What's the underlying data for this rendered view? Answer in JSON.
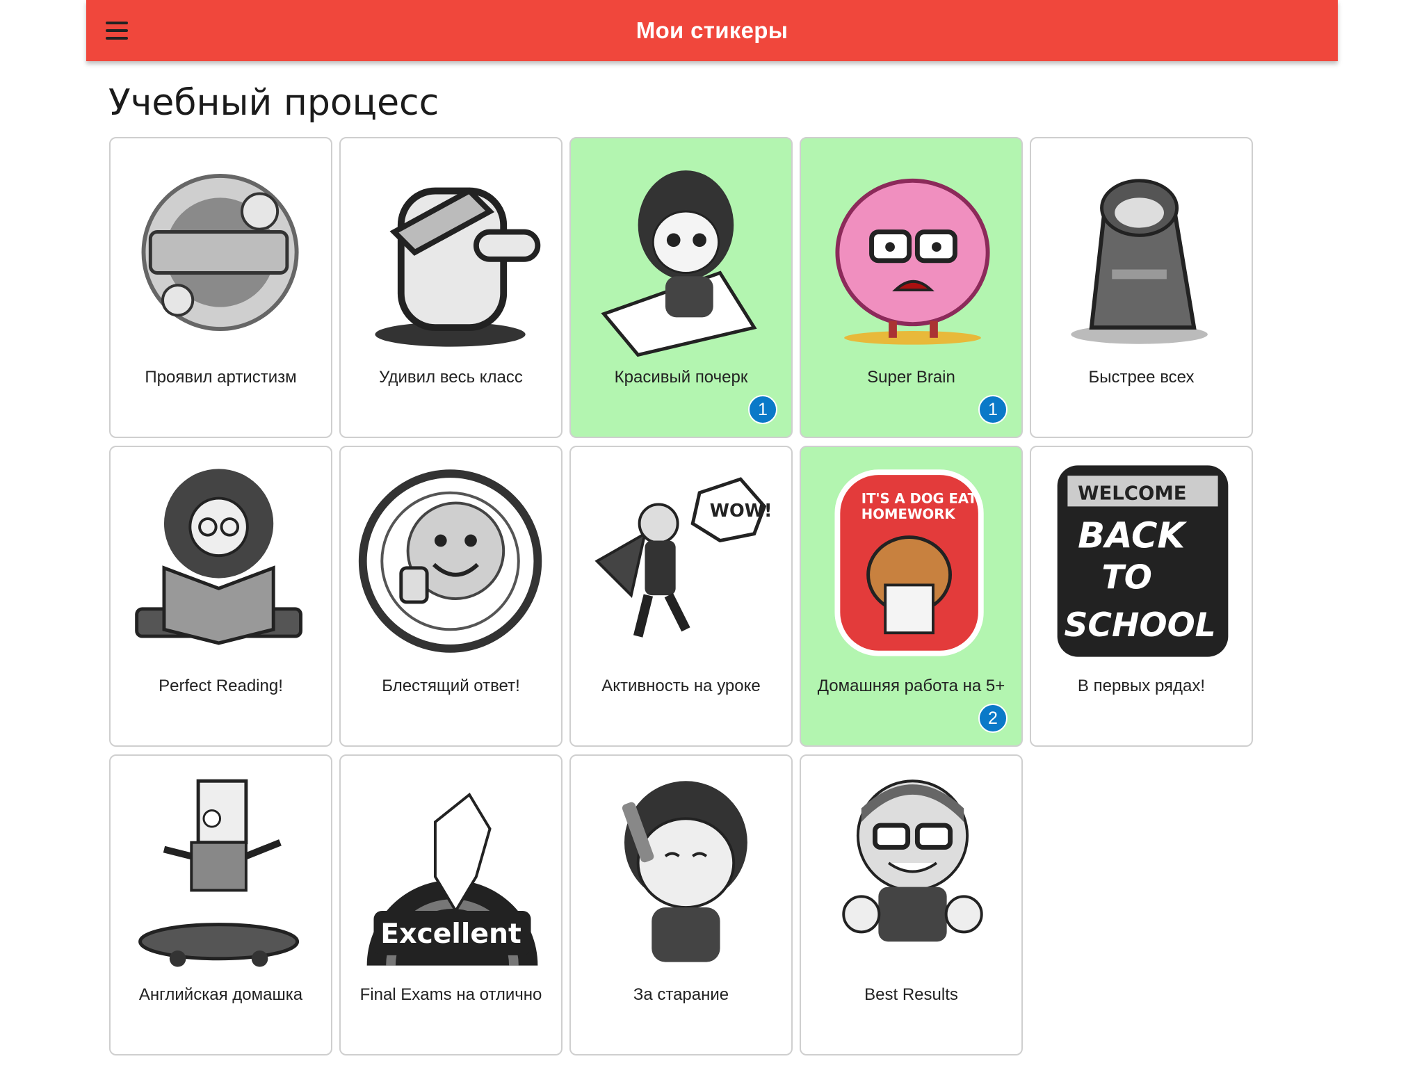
{
  "header": {
    "title": "Мои стикеры",
    "menu_icon": "hamburger-menu-icon",
    "background": "#f0473c"
  },
  "section": {
    "title": "Учебный процесс"
  },
  "colors": {
    "earned_card": "#b3f5b0",
    "badge": "#0a79c8"
  },
  "stickers": [
    {
      "label": "Проявил артистизм",
      "icon": "make-it-pop-sticker-icon",
      "earned": false,
      "count": ""
    },
    {
      "label": "Удивил весь класс",
      "icon": "dabbing-bulldog-sticker-icon",
      "earned": false,
      "count": ""
    },
    {
      "label": "Красивый почерк",
      "icon": "anime-girl-writing-sticker-icon",
      "earned": true,
      "count": "1"
    },
    {
      "label": "Super Brain",
      "icon": "brain-with-glasses-sticker-icon",
      "earned": true,
      "count": "1"
    },
    {
      "label": "Быстрее всех",
      "icon": "sloth-flash-sticker-icon",
      "earned": false,
      "count": ""
    },
    {
      "label": "Perfect Reading!",
      "icon": "girl-reading-book-sticker-icon",
      "earned": false,
      "count": ""
    },
    {
      "label": "Блестящий ответ!",
      "icon": "excellent-work-smiley-sticker-icon",
      "earned": false,
      "count": ""
    },
    {
      "label": "Активность на уроке",
      "icon": "superhero-wow-sticker-icon",
      "earned": false,
      "count": ""
    },
    {
      "label": "Домашняя работа на 5+",
      "icon": "dog-eat-homework-sticker-icon",
      "earned": true,
      "count": "2"
    },
    {
      "label": "В первых рядах!",
      "icon": "welcome-back-to-school-sticker-icon",
      "earned": false,
      "count": ""
    },
    {
      "label": "Английская домашка",
      "icon": "skateboarder-sticker-icon",
      "earned": false,
      "count": ""
    },
    {
      "label": "Final Exams на отлично",
      "icon": "excellent-unicorn-sticker-icon",
      "earned": false,
      "count": ""
    },
    {
      "label": "За старание",
      "icon": "thinking-boy-sticker-icon",
      "earned": false,
      "count": ""
    },
    {
      "label": "Best Results",
      "icon": "thumbs-up-boy-sticker-icon",
      "earned": false,
      "count": ""
    }
  ]
}
